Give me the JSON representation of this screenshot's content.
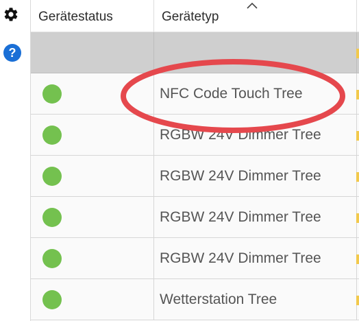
{
  "colors": {
    "status_ok": "#74c14f",
    "help_icon": "#1a6fd6",
    "highlight_ring": "#e5484d",
    "filter_row": "#cfcfcf",
    "edge_marker": "#f2c94c"
  },
  "toolbar": {
    "settings_icon": "gear-icon",
    "help_icon": "help-icon",
    "help_glyph": "?"
  },
  "table": {
    "columns": [
      "Gerätestatus",
      "Gerätetyp"
    ],
    "sorted_column": "Gerätetyp",
    "rows": [
      {
        "status": "ok",
        "type": "NFC Code Touch Tree"
      },
      {
        "status": "ok",
        "type": "RGBW 24V Dimmer Tree"
      },
      {
        "status": "ok",
        "type": "RGBW 24V Dimmer Tree"
      },
      {
        "status": "ok",
        "type": "RGBW 24V Dimmer Tree"
      },
      {
        "status": "ok",
        "type": "RGBW 24V Dimmer Tree"
      },
      {
        "status": "ok",
        "type": "Wetterstation Tree"
      }
    ]
  }
}
